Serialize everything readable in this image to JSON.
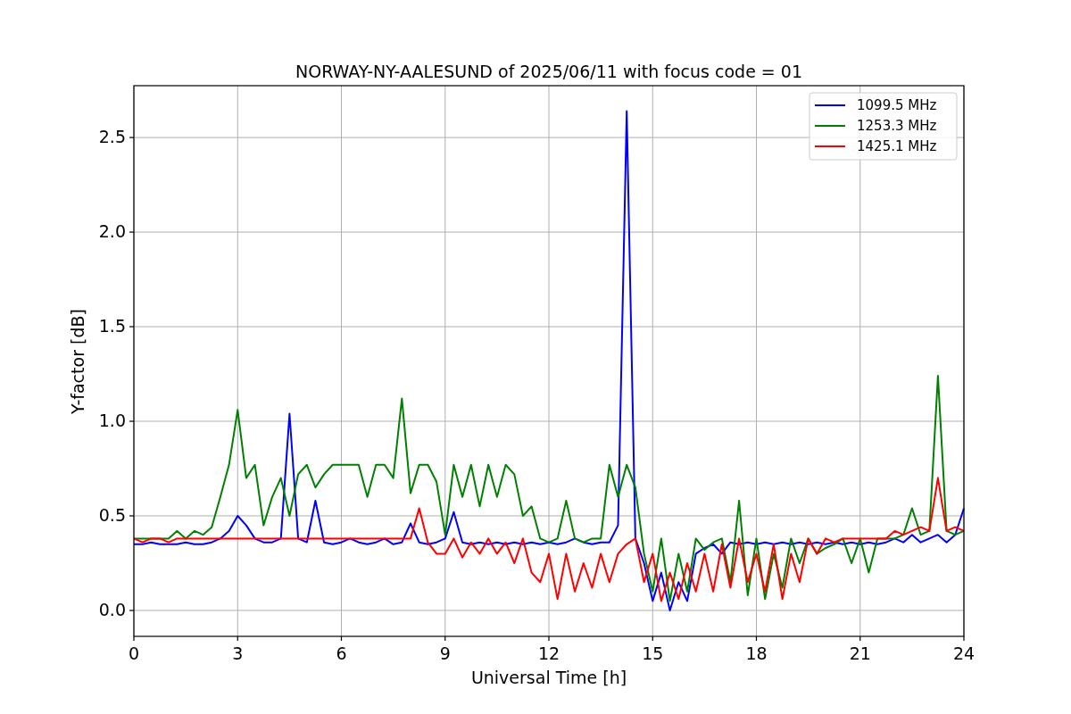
{
  "chart_data": {
    "type": "line",
    "title": "NORWAY-NY-AALESUND of 2025/06/11 with focus code = 01",
    "xlabel": "Universal Time [h]",
    "ylabel": "Y-factor [dB]",
    "x": [
      0,
      0.25,
      0.5,
      0.75,
      1,
      1.25,
      1.5,
      1.75,
      2,
      2.25,
      2.5,
      2.75,
      3,
      3.25,
      3.5,
      3.75,
      4,
      4.25,
      4.5,
      4.75,
      5,
      5.25,
      5.5,
      5.75,
      6,
      6.25,
      6.5,
      6.75,
      7,
      7.25,
      7.5,
      7.75,
      8,
      8.25,
      8.5,
      8.75,
      9,
      9.25,
      9.5,
      9.75,
      10,
      10.25,
      10.5,
      10.75,
      11,
      11.25,
      11.5,
      11.75,
      12,
      12.25,
      12.5,
      12.75,
      13,
      13.25,
      13.5,
      13.75,
      14,
      14.25,
      14.5,
      14.75,
      15,
      15.25,
      15.5,
      15.75,
      16,
      16.25,
      16.5,
      16.75,
      17,
      17.25,
      17.5,
      17.75,
      18,
      18.25,
      18.5,
      18.75,
      19,
      19.25,
      19.5,
      19.75,
      20,
      20.25,
      20.5,
      20.75,
      21,
      21.25,
      21.5,
      21.75,
      22,
      22.25,
      22.5,
      22.75,
      23,
      23.25,
      23.5,
      23.75,
      24
    ],
    "series": [
      {
        "name": "1099.5 MHz",
        "color": "#0000ff",
        "values": [
          0.35,
          0.35,
          0.36,
          0.35,
          0.35,
          0.35,
          0.36,
          0.35,
          0.35,
          0.36,
          0.38,
          0.42,
          0.5,
          0.45,
          0.38,
          0.36,
          0.36,
          0.38,
          1.04,
          0.38,
          0.36,
          0.58,
          0.36,
          0.35,
          0.36,
          0.38,
          0.36,
          0.35,
          0.36,
          0.38,
          0.35,
          0.36,
          0.46,
          0.36,
          0.35,
          0.36,
          0.38,
          0.52,
          0.36,
          0.35,
          0.36,
          0.35,
          0.36,
          0.35,
          0.36,
          0.35,
          0.36,
          0.35,
          0.36,
          0.35,
          0.36,
          0.38,
          0.36,
          0.35,
          0.36,
          0.36,
          0.45,
          2.64,
          0.38,
          0.25,
          0.05,
          0.2,
          0.0,
          0.15,
          0.05,
          0.3,
          0.33,
          0.35,
          0.3,
          0.36,
          0.35,
          0.36,
          0.35,
          0.36,
          0.35,
          0.36,
          0.35,
          0.36,
          0.35,
          0.36,
          0.35,
          0.36,
          0.35,
          0.36,
          0.35,
          0.36,
          0.35,
          0.36,
          0.38,
          0.36,
          0.4,
          0.36,
          0.38,
          0.4,
          0.36,
          0.4,
          0.54
        ]
      },
      {
        "name": "1253.3 MHz",
        "color": "#008000",
        "values": [
          0.38,
          0.38,
          0.38,
          0.38,
          0.38,
          0.42,
          0.38,
          0.42,
          0.4,
          0.44,
          0.6,
          0.77,
          1.06,
          0.7,
          0.77,
          0.45,
          0.6,
          0.7,
          0.5,
          0.72,
          0.77,
          0.65,
          0.72,
          0.77,
          0.77,
          0.77,
          0.77,
          0.6,
          0.77,
          0.77,
          0.7,
          1.12,
          0.62,
          0.77,
          0.77,
          0.68,
          0.4,
          0.77,
          0.6,
          0.77,
          0.55,
          0.77,
          0.6,
          0.77,
          0.72,
          0.5,
          0.55,
          0.38,
          0.36,
          0.38,
          0.58,
          0.38,
          0.36,
          0.38,
          0.38,
          0.77,
          0.6,
          0.77,
          0.65,
          0.3,
          0.1,
          0.38,
          0.05,
          0.3,
          0.1,
          0.38,
          0.32,
          0.36,
          0.38,
          0.15,
          0.58,
          0.08,
          0.38,
          0.06,
          0.3,
          0.12,
          0.38,
          0.25,
          0.38,
          0.3,
          0.33,
          0.35,
          0.38,
          0.25,
          0.38,
          0.2,
          0.38,
          0.38,
          0.38,
          0.4,
          0.54,
          0.4,
          0.42,
          1.24,
          0.42,
          0.4,
          0.42
        ]
      },
      {
        "name": "1425.1 MHz",
        "color": "#ff0000",
        "values": [
          0.38,
          0.36,
          0.38,
          0.38,
          0.36,
          0.38,
          0.38,
          0.38,
          0.38,
          0.38,
          0.38,
          0.38,
          0.38,
          0.38,
          0.38,
          0.38,
          0.38,
          0.38,
          0.38,
          0.38,
          0.38,
          0.38,
          0.38,
          0.38,
          0.38,
          0.38,
          0.38,
          0.38,
          0.38,
          0.38,
          0.38,
          0.38,
          0.38,
          0.54,
          0.36,
          0.3,
          0.3,
          0.38,
          0.28,
          0.36,
          0.3,
          0.38,
          0.3,
          0.36,
          0.25,
          0.38,
          0.2,
          0.15,
          0.3,
          0.06,
          0.3,
          0.1,
          0.25,
          0.12,
          0.3,
          0.15,
          0.3,
          0.35,
          0.38,
          0.15,
          0.3,
          0.05,
          0.2,
          0.06,
          0.25,
          0.1,
          0.3,
          0.1,
          0.35,
          0.12,
          0.38,
          0.15,
          0.3,
          0.1,
          0.35,
          0.06,
          0.3,
          0.15,
          0.38,
          0.3,
          0.38,
          0.36,
          0.38,
          0.38,
          0.38,
          0.38,
          0.38,
          0.38,
          0.42,
          0.4,
          0.42,
          0.44,
          0.42,
          0.7,
          0.42,
          0.44,
          0.42
        ]
      }
    ],
    "grid": true,
    "legend": true,
    "xlim": [
      0,
      24
    ],
    "ylim": [
      -0.137,
      2.774
    ],
    "xticks": [
      0,
      3,
      6,
      9,
      12,
      15,
      18,
      21,
      24
    ],
    "yticks": [
      {
        "value": 0,
        "label": "0.0"
      },
      {
        "value": 0.5,
        "label": "0.5"
      },
      {
        "value": 1,
        "label": "1.0"
      },
      {
        "value": 1.5,
        "label": "1.5"
      },
      {
        "value": 2,
        "label": "2.0"
      },
      {
        "value": 2.5,
        "label": "2.5"
      }
    ]
  }
}
